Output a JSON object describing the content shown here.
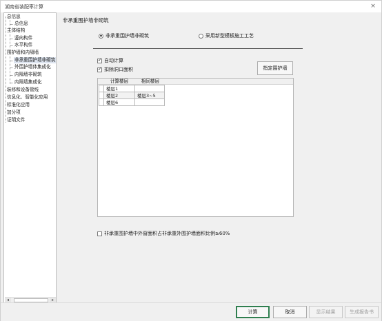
{
  "window": {
    "title": "湖南省装配率计算",
    "close_symbol": "×"
  },
  "tree": {
    "items": [
      {
        "label": "总信息"
      },
      {
        "label": "总信息"
      },
      {
        "label": "主体结构"
      },
      {
        "label": "竖向构件"
      },
      {
        "label": "水平构件"
      },
      {
        "label": "围护墙和内隔墙"
      },
      {
        "label": "非承重围护墙非砌筑",
        "selected": true
      },
      {
        "label": "外围护墙体集成化"
      },
      {
        "label": "内隔墙非砌筑"
      },
      {
        "label": "内隔墙集成化"
      },
      {
        "label": "装修和设备管线"
      },
      {
        "label": "信息化、智能化应用"
      },
      {
        "label": "标准化应用"
      },
      {
        "label": "加分项"
      },
      {
        "label": "证明文件"
      }
    ],
    "scroll_left": "◂",
    "scroll_right": "▸"
  },
  "main": {
    "section_title": "非承重围护墙非砌筑",
    "radio_options": [
      {
        "label": "非承重围护墙非砌筑",
        "selected": true
      },
      {
        "label": "采用新型模板施工工艺",
        "selected": false
      }
    ],
    "auto_calc": {
      "label": "自动计算",
      "checked": true
    },
    "deduct_openings": {
      "label": "扣除洞口面积",
      "checked": true
    },
    "assign_wall_button": "指定围护墙",
    "grid": {
      "headers": [
        "计算楼层",
        "相同楼层"
      ],
      "rows": [
        {
          "floor": "楼层1",
          "same": ""
        },
        {
          "floor": "楼层2",
          "same": "楼层3~5"
        },
        {
          "floor": "楼层6",
          "same": ""
        }
      ]
    },
    "ratio_check": {
      "label": "非承重围护墙中外窗面积占非承重外围护墙面积比例≥60%",
      "checked": false
    }
  },
  "buttons": {
    "calculate": "计算",
    "cancel": "取消",
    "show_result": "显示结果",
    "generate_report": "生成报告书"
  }
}
